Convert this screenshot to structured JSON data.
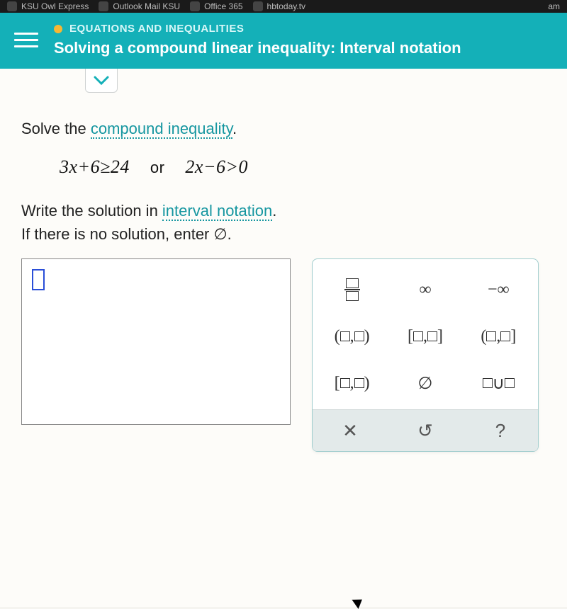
{
  "browser": {
    "bookmarks": [
      "KSU Owl Express",
      "Outlook Mail KSU",
      "Office 365",
      "hbtoday.tv",
      "am"
    ]
  },
  "header": {
    "category": "EQUATIONS AND INEQUALITIES",
    "lesson": "Solving a compound linear inequality: Interval notation"
  },
  "prompt": {
    "lead": "Solve the ",
    "link": "compound inequality",
    "tail": "."
  },
  "inequality": {
    "left": "3x+6≥24",
    "word": "or",
    "right": "2x−6>0"
  },
  "instruction": {
    "line1a": "Write the solution in ",
    "line1_link": "interval notation",
    "line1b": ".",
    "line2": "If there is no solution, enter ∅."
  },
  "keypad": {
    "infinity": "∞",
    "neg_infinity": "−∞",
    "open_open": "(□,□)",
    "closed_closed": "[□,□]",
    "open_closed": "(□,□]",
    "closed_open": "[□,□)",
    "empty_set": "∅",
    "union": "□∪□",
    "clear": "✕",
    "undo": "↺",
    "help": "?"
  }
}
